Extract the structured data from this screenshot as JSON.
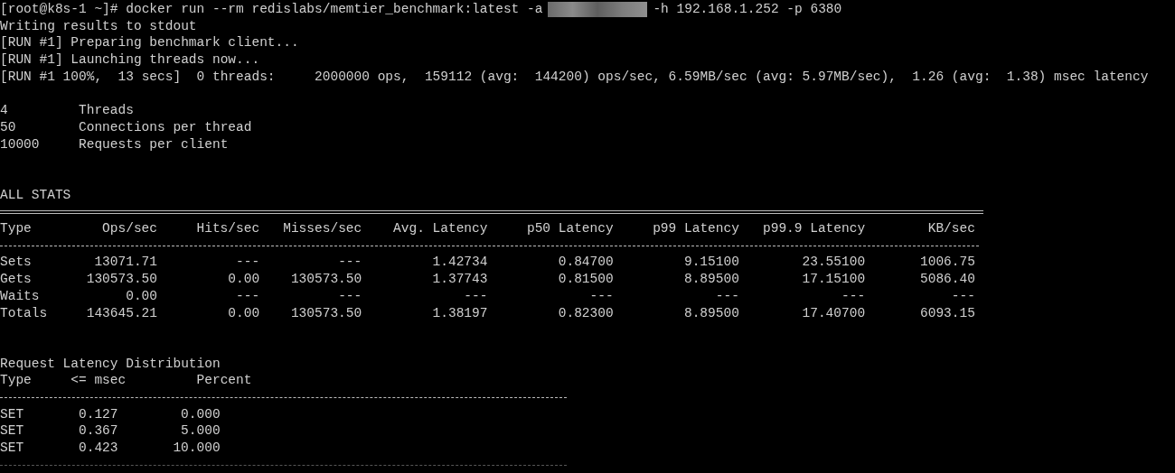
{
  "command": {
    "before_redaction": "[root@k8s-1 ~]# docker run --rm redislabs/memtier_benchmark:latest -a",
    "after_redaction": "-h 192.168.1.252 -p 6380"
  },
  "output_lines": [
    "Writing results to stdout",
    "[RUN #1] Preparing benchmark client...",
    "[RUN #1] Launching threads now...",
    "[RUN #1 100%,  13 secs]  0 threads:     2000000 ops,  159112 (avg:  144200) ops/sec, 6.59MB/sec (avg: 5.97MB/sec),  1.26 (avg:  1.38) msec latency"
  ],
  "config": [
    {
      "value": "4",
      "label": "Threads"
    },
    {
      "value": "50",
      "label": "Connections per thread"
    },
    {
      "value": "10000",
      "label": "Requests per client"
    }
  ],
  "all_stats": {
    "title": "ALL STATS",
    "columns": [
      "Type",
      "Ops/sec",
      "Hits/sec",
      "Misses/sec",
      "Avg. Latency",
      "p50 Latency",
      "p99 Latency",
      "p99.9 Latency",
      "KB/sec"
    ],
    "rows": [
      [
        "Sets",
        "13071.71",
        "---",
        "---",
        "1.42734",
        "0.84700",
        "9.15100",
        "23.55100",
        "1006.75"
      ],
      [
        "Gets",
        "130573.50",
        "0.00",
        "130573.50",
        "1.37743",
        "0.81500",
        "8.89500",
        "17.15100",
        "5086.40"
      ],
      [
        "Waits",
        "0.00",
        "---",
        "---",
        "---",
        "---",
        "---",
        "---",
        "---"
      ],
      [
        "Totals",
        "143645.21",
        "0.00",
        "130573.50",
        "1.38197",
        "0.82300",
        "8.89500",
        "17.40700",
        "6093.15"
      ]
    ]
  },
  "latency_distribution": {
    "title": "Request Latency Distribution",
    "columns": [
      "Type",
      "<= msec",
      "Percent"
    ],
    "rows": [
      [
        "SET",
        "0.127",
        "0.000"
      ],
      [
        "SET",
        "0.367",
        "5.000"
      ],
      [
        "SET",
        "0.423",
        "10.000"
      ]
    ]
  }
}
